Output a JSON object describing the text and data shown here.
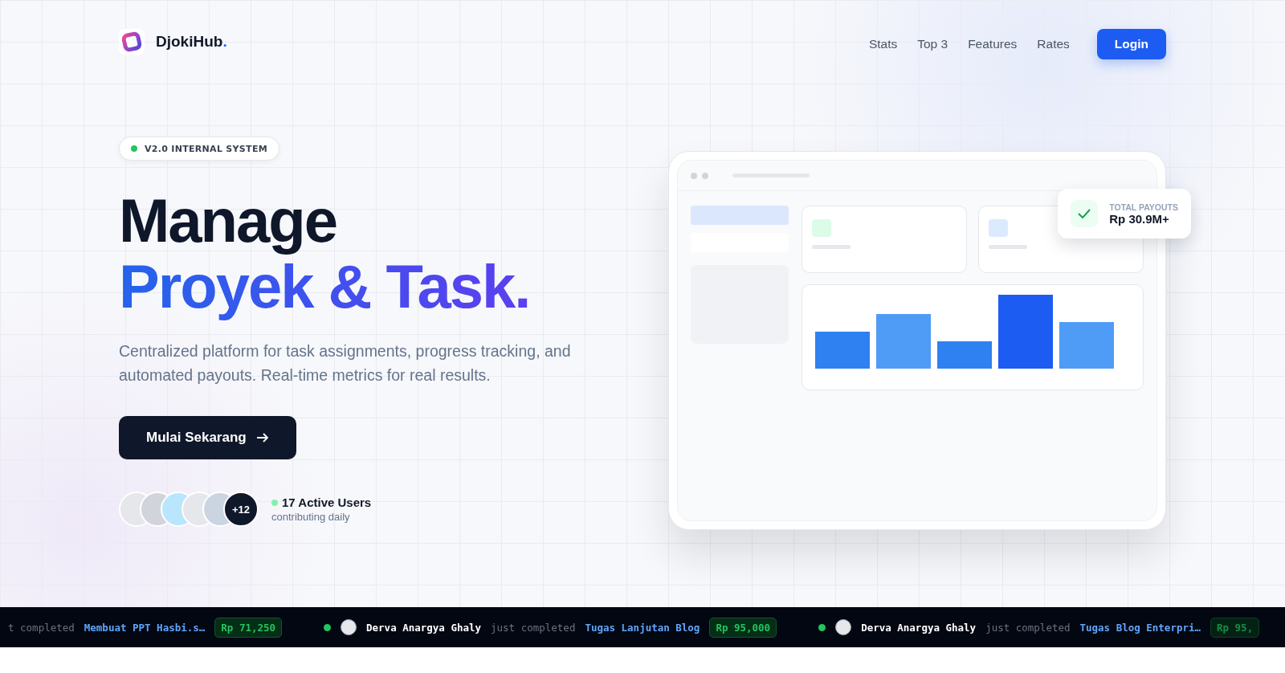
{
  "nav": {
    "brand": "DjokiHub",
    "brand_dot": ".",
    "links": [
      "Stats",
      "Top 3",
      "Features",
      "Rates"
    ],
    "login": "Login"
  },
  "badge": {
    "label": "V2.0 INTERNAL SYSTEM",
    "online": true
  },
  "headline": {
    "line_1": "Manage",
    "line_2": "Proyek & Task."
  },
  "description": "Centralized platform for task assignments, progress tracking, and automated payouts. Real-time metrics for real results.",
  "cta": "Mulai Sekarang",
  "users": {
    "extra": "+12",
    "title": "17 Active Users",
    "subtitle": "contributing daily"
  },
  "payout": {
    "label": "TOTAL PAYOUTS",
    "value": "Rp 30.9M+"
  },
  "ticker": [
    {
      "verb": "t completed",
      "task": "Membuat PPT Hasbi.s…",
      "amount": "Rp 71,250",
      "faded": false
    },
    {
      "name": "Derva Anargya Ghaly",
      "verb": "just completed",
      "task": "Tugas Lanjutan Blog",
      "amount": "Rp 95,000",
      "faded": false
    },
    {
      "name": "Derva Anargya Ghaly",
      "verb": "just completed",
      "task": "Tugas Blog Enterpri…",
      "amount": "Rp 95,",
      "faded": true
    }
  ]
}
